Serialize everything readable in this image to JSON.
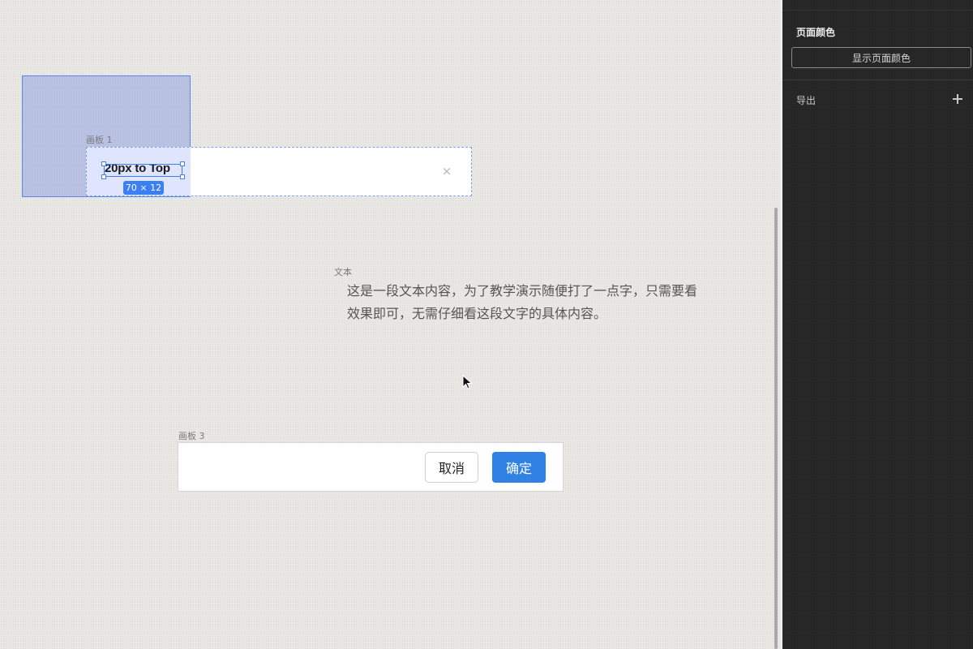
{
  "canvas": {
    "board1": {
      "label": "画板 1",
      "text": "20px to Top",
      "dimension_badge": "70 × 12",
      "close_icon": "×"
    },
    "text_layer": {
      "label": "文本",
      "paragraph": "这是一段文本内容，为了教学演示随便打了一点字，只需要看效果即可，无需仔细看这段文字的具体内容。"
    },
    "board3": {
      "label": "画板 3",
      "cancel_label": "取消",
      "ok_label": "确定"
    }
  },
  "sidebar": {
    "page_color_title": "页面颜色",
    "show_page_color_button": "显示页面颜色",
    "export_label": "导出",
    "add_icon": "plus-icon"
  },
  "colors": {
    "accent": "#2f81e4",
    "selection": "#3b7ff2",
    "panel_bg": "#262626"
  }
}
